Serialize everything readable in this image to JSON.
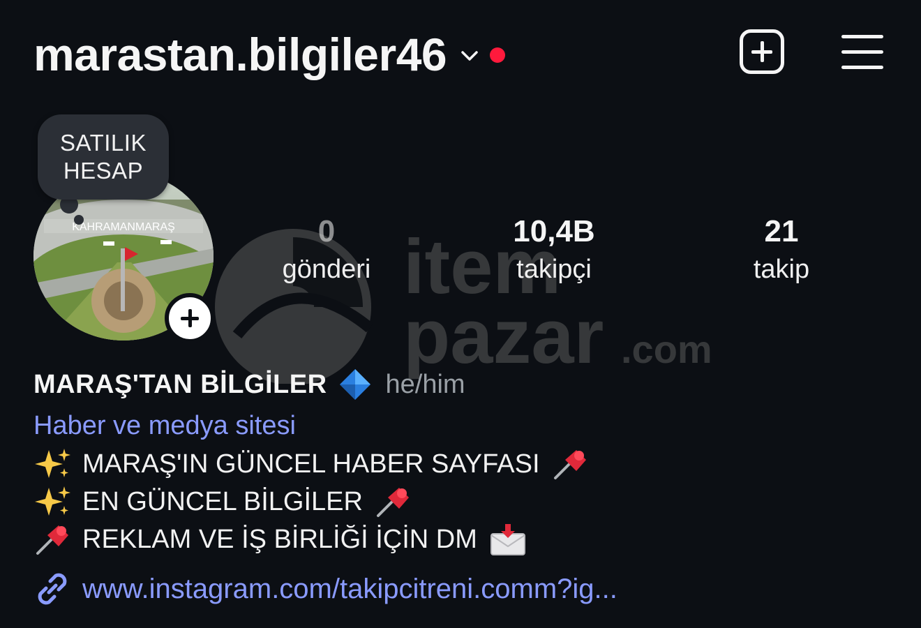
{
  "header": {
    "username": "marastan.bilgiler46",
    "icons": {
      "chevron": "chevron-down-icon",
      "new_post": "add-post-icon",
      "menu": "hamburger-menu-icon",
      "notification": "red-dot"
    }
  },
  "avatar": {
    "image_text": "KAHRAMANMARAŞ",
    "note_line1": "SATILIK",
    "note_line2": "HESAP"
  },
  "stats": [
    {
      "value": "0",
      "label": "gönderi"
    },
    {
      "value": "10,4B",
      "label": "takipçi"
    },
    {
      "value": "21",
      "label": "takip"
    }
  ],
  "watermark": {
    "line1": "item",
    "line2": "pazar",
    "suffix": ".com"
  },
  "profile": {
    "name": "MARAŞ'TAN BİLGİLER",
    "pronouns": "he/him",
    "category": "Haber ve medya sitesi",
    "bio_lines": [
      "MARAŞ'IN GÜNCEL HABER SAYFASI",
      "EN GÜNCEL BİLGİLER",
      "REKLAM VE İŞ BİRLİĞİ İÇİN DM"
    ],
    "link": "www.instagram.com/takipcitreni.comm?ig..."
  },
  "colors": {
    "background": "#0c0f14",
    "link": "#8a9bff",
    "notification_dot": "#ff1a3c",
    "pronouns": "#9aa0a6"
  }
}
